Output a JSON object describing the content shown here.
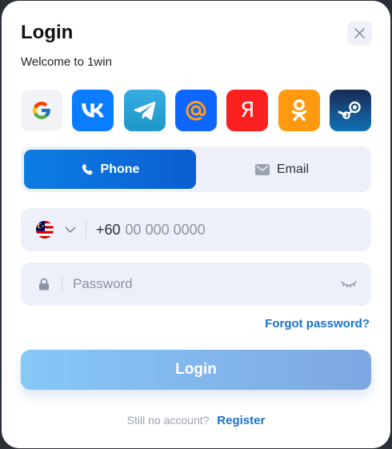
{
  "dialog": {
    "title": "Login",
    "subtitle": "Welcome to 1win",
    "close_icon": "close-icon"
  },
  "social": {
    "providers": [
      {
        "name": "Google",
        "icon": "google-icon"
      },
      {
        "name": "VK",
        "icon": "vk-icon"
      },
      {
        "name": "Telegram",
        "icon": "telegram-icon"
      },
      {
        "name": "Mail.ru",
        "icon": "at-sign-icon"
      },
      {
        "name": "Yandex",
        "icon": "yandex-icon",
        "glyph": "Я"
      },
      {
        "name": "Odnoklassniki",
        "icon": "odnoklassniki-icon"
      },
      {
        "name": "Steam",
        "icon": "steam-icon"
      }
    ]
  },
  "tabs": {
    "phone_label": "Phone",
    "email_label": "Email",
    "selected": "Phone"
  },
  "phone": {
    "country": "Malaysia",
    "country_code": "+60",
    "placeholder": "00 000 0000",
    "value": ""
  },
  "password": {
    "placeholder": "Password",
    "value": ""
  },
  "links": {
    "forgot": "Forgot password?",
    "no_account": "Still no account?",
    "register": "Register"
  },
  "buttons": {
    "login": "Login"
  },
  "colors": {
    "primary": "#0b6fda",
    "link": "#1a73c8",
    "field_bg": "#edf0f8"
  }
}
